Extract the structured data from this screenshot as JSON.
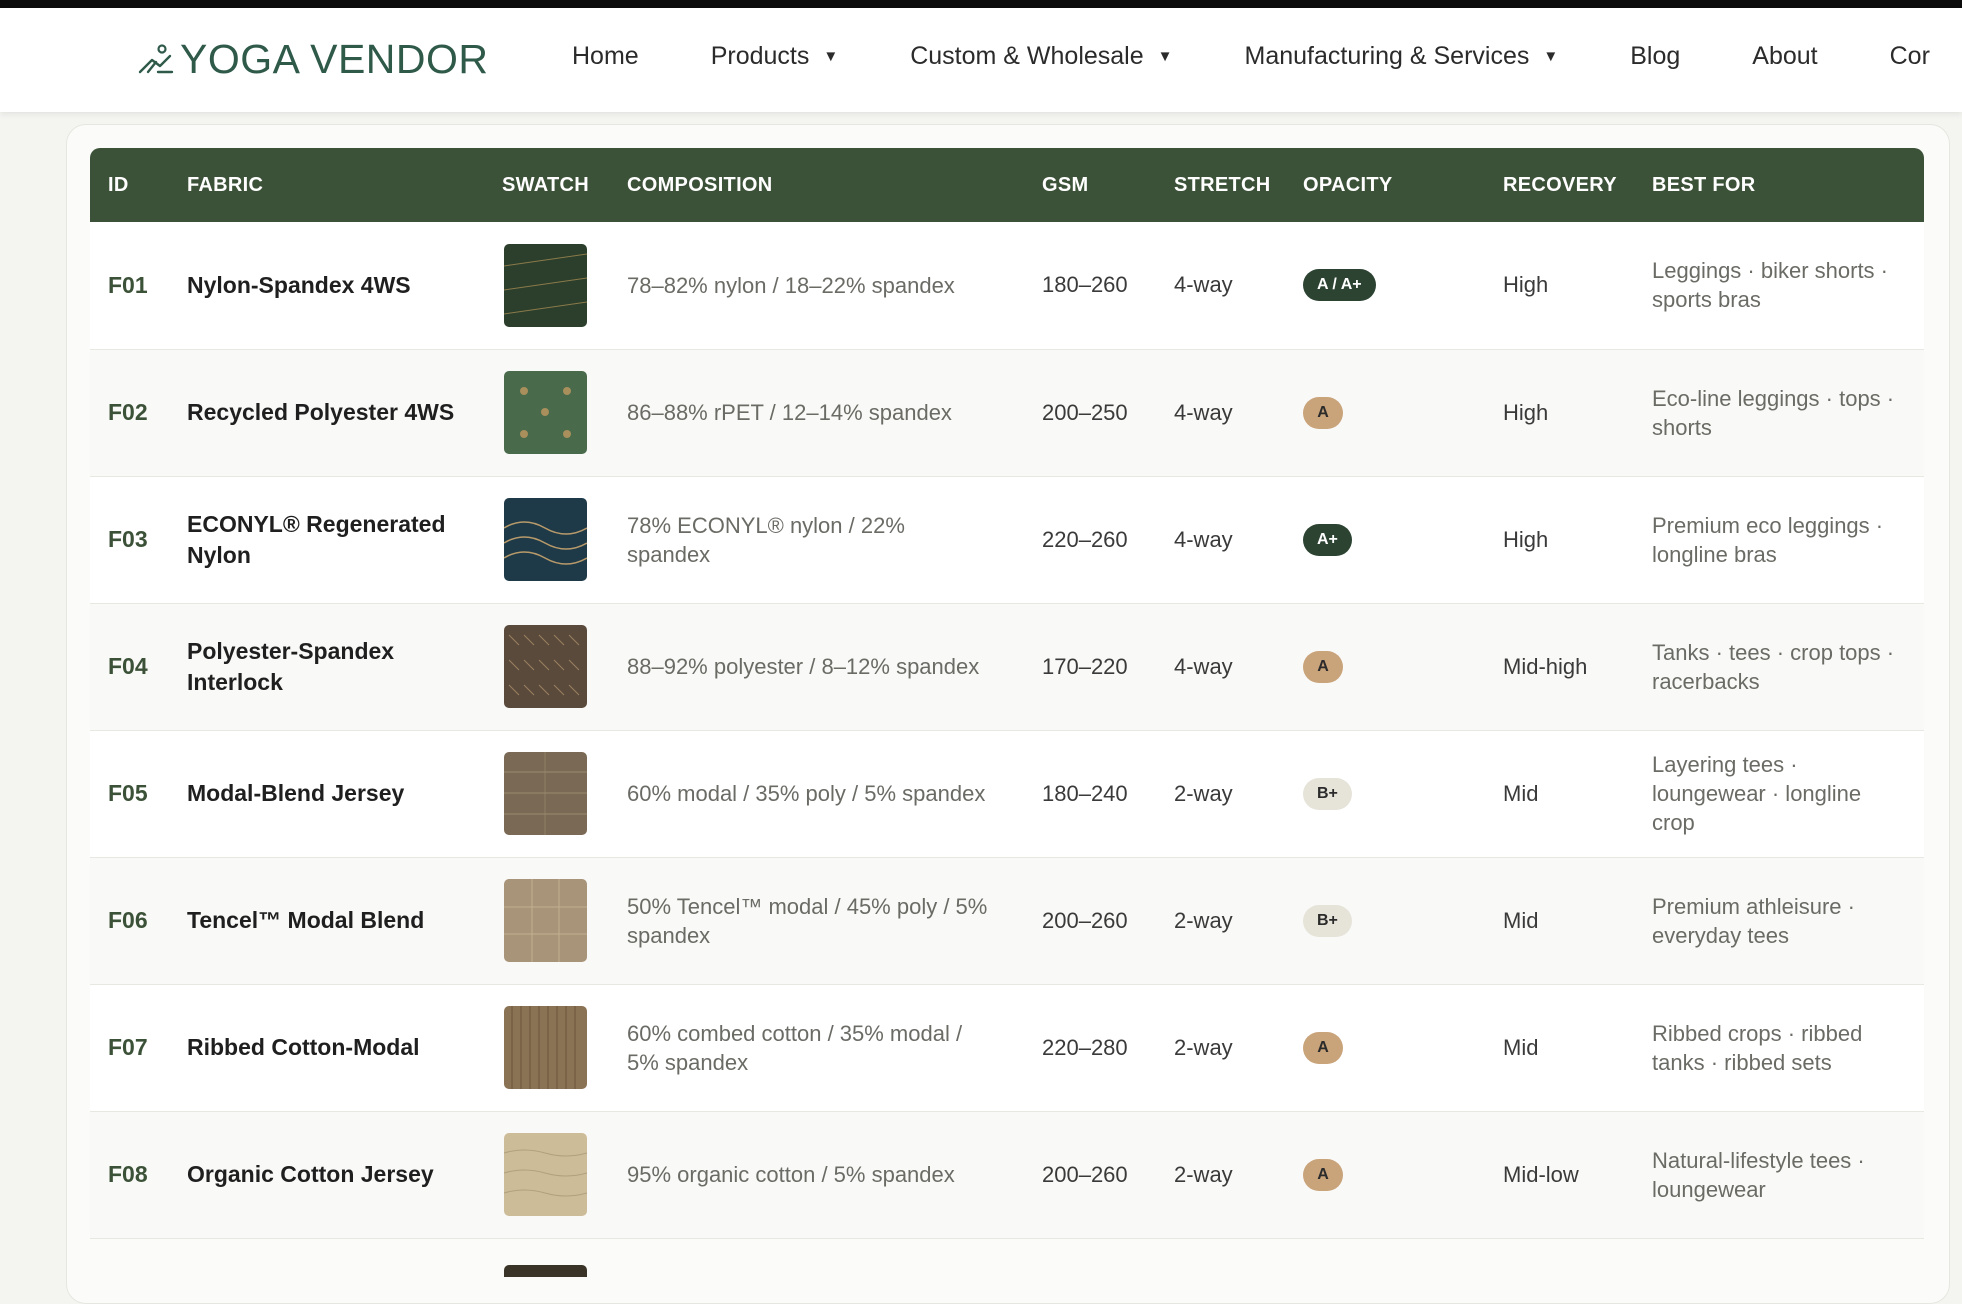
{
  "header": {
    "logo_text": "YOGA VENDOR",
    "nav": [
      {
        "label": "Home",
        "dropdown": false
      },
      {
        "label": "Products",
        "dropdown": true
      },
      {
        "label": "Custom & Wholesale",
        "dropdown": true
      },
      {
        "label": "Manufacturing & Services",
        "dropdown": true
      },
      {
        "label": "Blog",
        "dropdown": false
      },
      {
        "label": "About",
        "dropdown": false
      },
      {
        "label": "Cor",
        "dropdown": false
      }
    ],
    "caret": "▼"
  },
  "table": {
    "columns": [
      "ID",
      "FABRIC",
      "SWATCH",
      "COMPOSITION",
      "GSM",
      "STRETCH",
      "OPACITY",
      "RECOVERY",
      "BEST FOR"
    ],
    "rows": [
      {
        "id": "F01",
        "fabric": "Nylon-Spandex 4WS",
        "swatch_color": "#2c3f2c",
        "composition": "78–82% nylon / 18–22% spandex",
        "gsm": "180–260",
        "stretch": "4-way",
        "opacity": "A / A+",
        "opacity_style": "dark",
        "recovery": "High",
        "best_for": "Leggings · biker shorts · sports bras"
      },
      {
        "id": "F02",
        "fabric": "Recycled Polyester 4WS",
        "swatch_color": "#4a6a4c",
        "composition": "86–88% rPET / 12–14% spandex",
        "gsm": "200–250",
        "stretch": "4-way",
        "opacity": "A",
        "opacity_style": "tan",
        "recovery": "High",
        "best_for": "Eco-line leggings · tops · shorts"
      },
      {
        "id": "F03",
        "fabric": "ECONYL® Regenerated Nylon",
        "swatch_color": "#1e3a48",
        "composition": "78% ECONYL® nylon / 22% spandex",
        "gsm": "220–260",
        "stretch": "4-way",
        "opacity": "A+",
        "opacity_style": "dark",
        "recovery": "High",
        "best_for": "Premium eco leggings · longline bras"
      },
      {
        "id": "F04",
        "fabric": "Polyester-Spandex Interlock",
        "swatch_color": "#5a4a3c",
        "composition": "88–92% polyester / 8–12% spandex",
        "gsm": "170–220",
        "stretch": "4-way",
        "opacity": "A",
        "opacity_style": "tan",
        "recovery": "Mid-high",
        "best_for": "Tanks · tees · crop tops · racerbacks"
      },
      {
        "id": "F05",
        "fabric": "Modal-Blend Jersey",
        "swatch_color": "#7a6a55",
        "composition": "60% modal / 35% poly / 5% spandex",
        "gsm": "180–240",
        "stretch": "2-way",
        "opacity": "B+",
        "opacity_style": "light",
        "recovery": "Mid",
        "best_for": "Layering tees · loungewear · longline crop"
      },
      {
        "id": "F06",
        "fabric": "Tencel™ Modal Blend",
        "swatch_color": "#a89478",
        "composition": "50% Tencel™ modal / 45% poly / 5% spandex",
        "gsm": "200–260",
        "stretch": "2-way",
        "opacity": "B+",
        "opacity_style": "light",
        "recovery": "Mid",
        "best_for": "Premium athleisure · everyday tees"
      },
      {
        "id": "F07",
        "fabric": "Ribbed Cotton-Modal",
        "swatch_color": "#8a7254",
        "composition": "60% combed cotton / 35% modal / 5% spandex",
        "gsm": "220–280",
        "stretch": "2-way",
        "opacity": "A",
        "opacity_style": "tan",
        "recovery": "Mid",
        "best_for": "Ribbed crops · ribbed tanks · ribbed sets"
      },
      {
        "id": "F08",
        "fabric": "Organic Cotton Jersey",
        "swatch_color": "#cdbc98",
        "composition": "95% organic cotton / 5% spandex",
        "gsm": "200–260",
        "stretch": "2-way",
        "opacity": "A",
        "opacity_style": "tan",
        "recovery": "Mid-low",
        "best_for": "Natural-lifestyle tees · loungewear"
      }
    ]
  },
  "colors": {
    "header_green": "#3c5238",
    "logo_green": "#2f5a4a",
    "badge_dark": "#2c4332",
    "badge_tan": "#c9a37a",
    "badge_light": "#e6e3d9"
  }
}
